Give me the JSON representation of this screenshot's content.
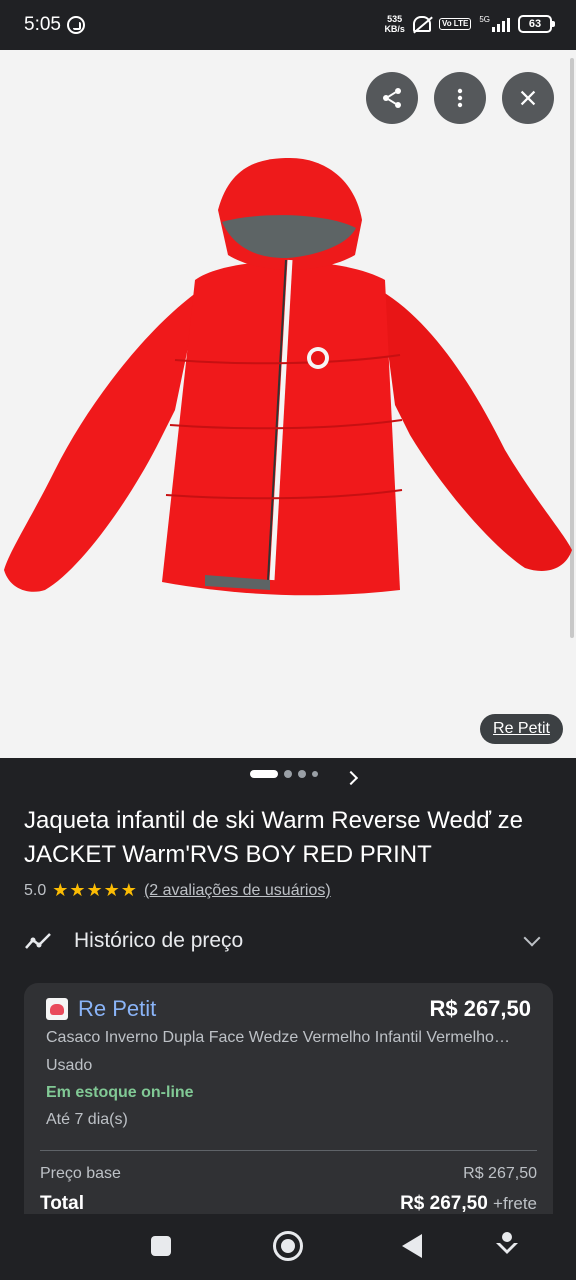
{
  "status_bar": {
    "time": "5:05",
    "speed_value": "535",
    "speed_unit": "KB/s",
    "volte": "Vo LTE",
    "network": "5G",
    "battery": "63"
  },
  "image_viewer": {
    "share_icon": "share-icon",
    "more_icon": "more-vert-icon",
    "close_icon": "close-icon",
    "source_label": "Re Petit",
    "slide_count": 4,
    "active_slide": 1
  },
  "product": {
    "title": "Jaqueta infantil de ski Warm Reverse Wedď ze JACKET Warm'RVS BOY RED PRINT",
    "rating": "5.0",
    "stars": "★★★★★",
    "reviews_link": "(2 avaliações de usuários)"
  },
  "price_history": {
    "label": "Histórico de preço"
  },
  "offer": {
    "merchant": "Re Petit",
    "price": "R$ 267,50",
    "description": "Casaco Inverno Dupla Face Wedze Vermelho Infantil Vermelho…",
    "condition": "Usado",
    "stock": "Em estoque on-line",
    "delivery": "Até 7 dia(s)",
    "base_label": "Preço base",
    "base_value": "R$ 267,50",
    "total_label": "Total",
    "total_value": "R$ 267,50",
    "shipping": "+frete"
  },
  "colors": {
    "accent_link": "#8ab4f8",
    "in_stock": "#81c995",
    "star": "#fbbc04",
    "jacket": "#f0191b"
  }
}
